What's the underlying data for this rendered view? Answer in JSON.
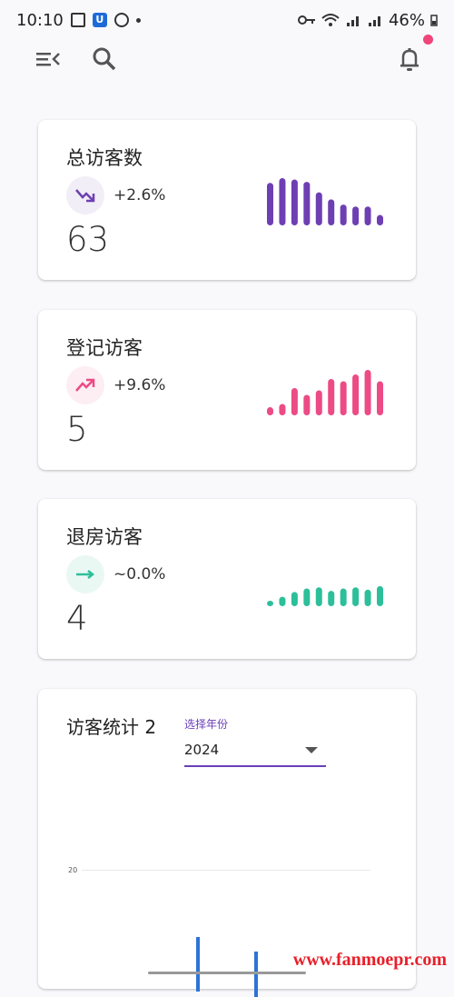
{
  "status": {
    "time": "10:10",
    "battery": "46%"
  },
  "cards": [
    {
      "title": "总访客数",
      "trend": "+2.6%",
      "value": "63",
      "color": "#6e3fb3",
      "circle": "#f1eef7",
      "spark": [
        0.9,
        1.0,
        0.97,
        0.92,
        0.7,
        0.55,
        0.44,
        0.4,
        0.4,
        0.22
      ]
    },
    {
      "title": "登记访客",
      "trend": "+9.6%",
      "value": "5",
      "color": "#ec4b85",
      "circle": "#fdeef3",
      "spark": [
        0.18,
        0.25,
        0.6,
        0.45,
        0.55,
        0.8,
        0.75,
        0.9,
        1.0,
        0.75
      ]
    },
    {
      "title": "退房访客",
      "trend": "~0.0%",
      "value": "4",
      "color": "#2dbf9a",
      "circle": "#eaf8f4",
      "spark": [
        0.2,
        0.4,
        0.6,
        0.75,
        0.8,
        0.65,
        0.75,
        0.8,
        0.7,
        0.85
      ]
    }
  ],
  "stats": {
    "title": "访客统计 2",
    "select_label": "选择年份",
    "select_value": "2024",
    "ytick": "20"
  },
  "watermark": "www.fanmoepr.com"
}
